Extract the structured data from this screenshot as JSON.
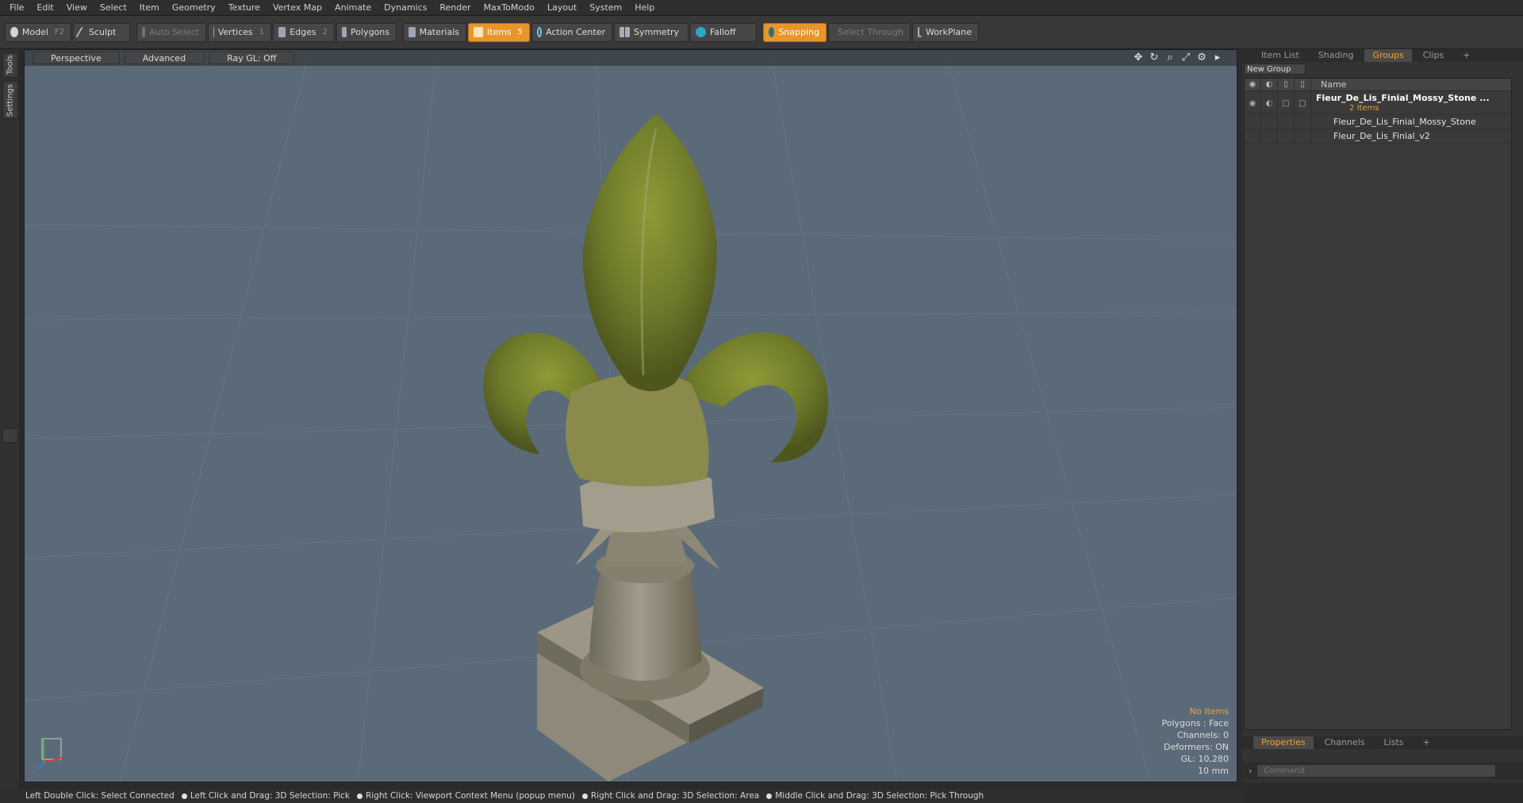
{
  "menu": [
    "File",
    "Edit",
    "View",
    "Select",
    "Item",
    "Geometry",
    "Texture",
    "Vertex Map",
    "Animate",
    "Dynamics",
    "Render",
    "MaxToModo",
    "Layout",
    "System",
    "Help"
  ],
  "toolbar": {
    "model": "Model",
    "model_key": "F2",
    "sculpt": "Sculpt",
    "auto_select": "Auto Select",
    "vertices": "Vertices",
    "vertices_key": "1",
    "edges": "Edges",
    "edges_key": "2",
    "polygons": "Polygons",
    "materials": "Materials",
    "items": "Items",
    "items_key": "5",
    "action_center": "Action Center",
    "symmetry": "Symmetry",
    "falloff": "Falloff",
    "snapping": "Snapping",
    "select_through": "Select Through",
    "workplane": "WorkPlane"
  },
  "left_tabs": {
    "tools": "Tools",
    "settings": "Settings"
  },
  "viewport": {
    "view_mode": "Perspective",
    "shading": "Advanced",
    "raygl": "Ray GL: Off",
    "info": {
      "selection": "No Items",
      "polygons": "Polygons : Face",
      "channels": "Channels: 0",
      "deformers": "Deformers: ON",
      "gl": "GL: 10,280",
      "unit": "10 mm"
    }
  },
  "right_panel": {
    "tabs": [
      "Item List",
      "Shading",
      "Groups",
      "Clips",
      "+"
    ],
    "active_tab": "Groups",
    "new_group": "New Group",
    "column_name": "Name",
    "group": {
      "name": "Fleur_De_Lis_Finial_Mossy_Stone ...",
      "count": "2 Items"
    },
    "children": [
      "Fleur_De_Lis_Finial_Mossy_Stone",
      "Fleur_De_Lis_Finial_v2"
    ],
    "bottom_tabs": [
      "Properties",
      "Channels",
      "Lists",
      "+"
    ],
    "command_placeholder": "Command"
  },
  "status_bar": [
    "Left Double Click: Select Connected",
    "Left Click and Drag: 3D Selection: Pick",
    "Right Click: Viewport Context Menu (popup menu)",
    "Right Click and Drag: 3D Selection: Area",
    "Middle Click and Drag: 3D Selection: Pick Through"
  ],
  "colors": {
    "accent": "#e8962a",
    "viewport_bg": "#5b6a78",
    "moss": "#7d8a2e",
    "stone": "#9a9486"
  }
}
